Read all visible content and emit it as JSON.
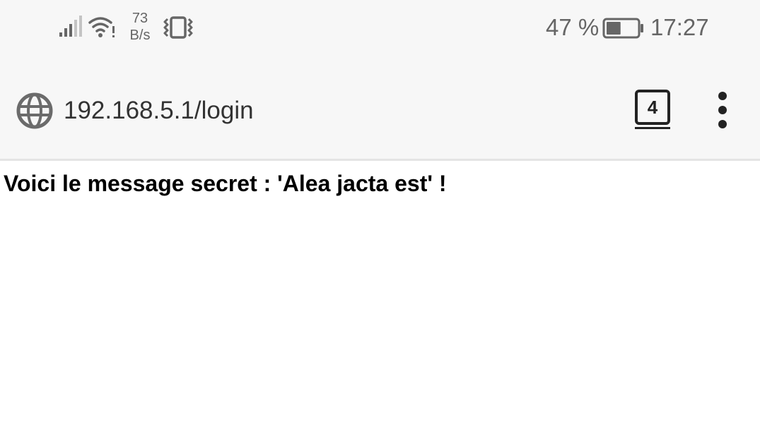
{
  "status_bar": {
    "network_speed_value": "73",
    "network_speed_unit": "B/s",
    "battery_percent": "47 %",
    "battery_level": 0.47,
    "time": "17:27",
    "icons": [
      "signal-icon",
      "wifi-icon",
      "vibrate-icon",
      "battery-icon"
    ]
  },
  "browser": {
    "url": "192.168.5.1/login",
    "tab_count": "4",
    "icons": [
      "globe-icon",
      "tabs-icon",
      "more-menu-icon"
    ]
  },
  "page": {
    "message": "Voici le message secret : 'Alea jacta est' !"
  },
  "colors": {
    "bar_background": "#f7f7f7",
    "status_text": "#666666",
    "icon_dark": "#222222",
    "page_text": "#000000"
  }
}
